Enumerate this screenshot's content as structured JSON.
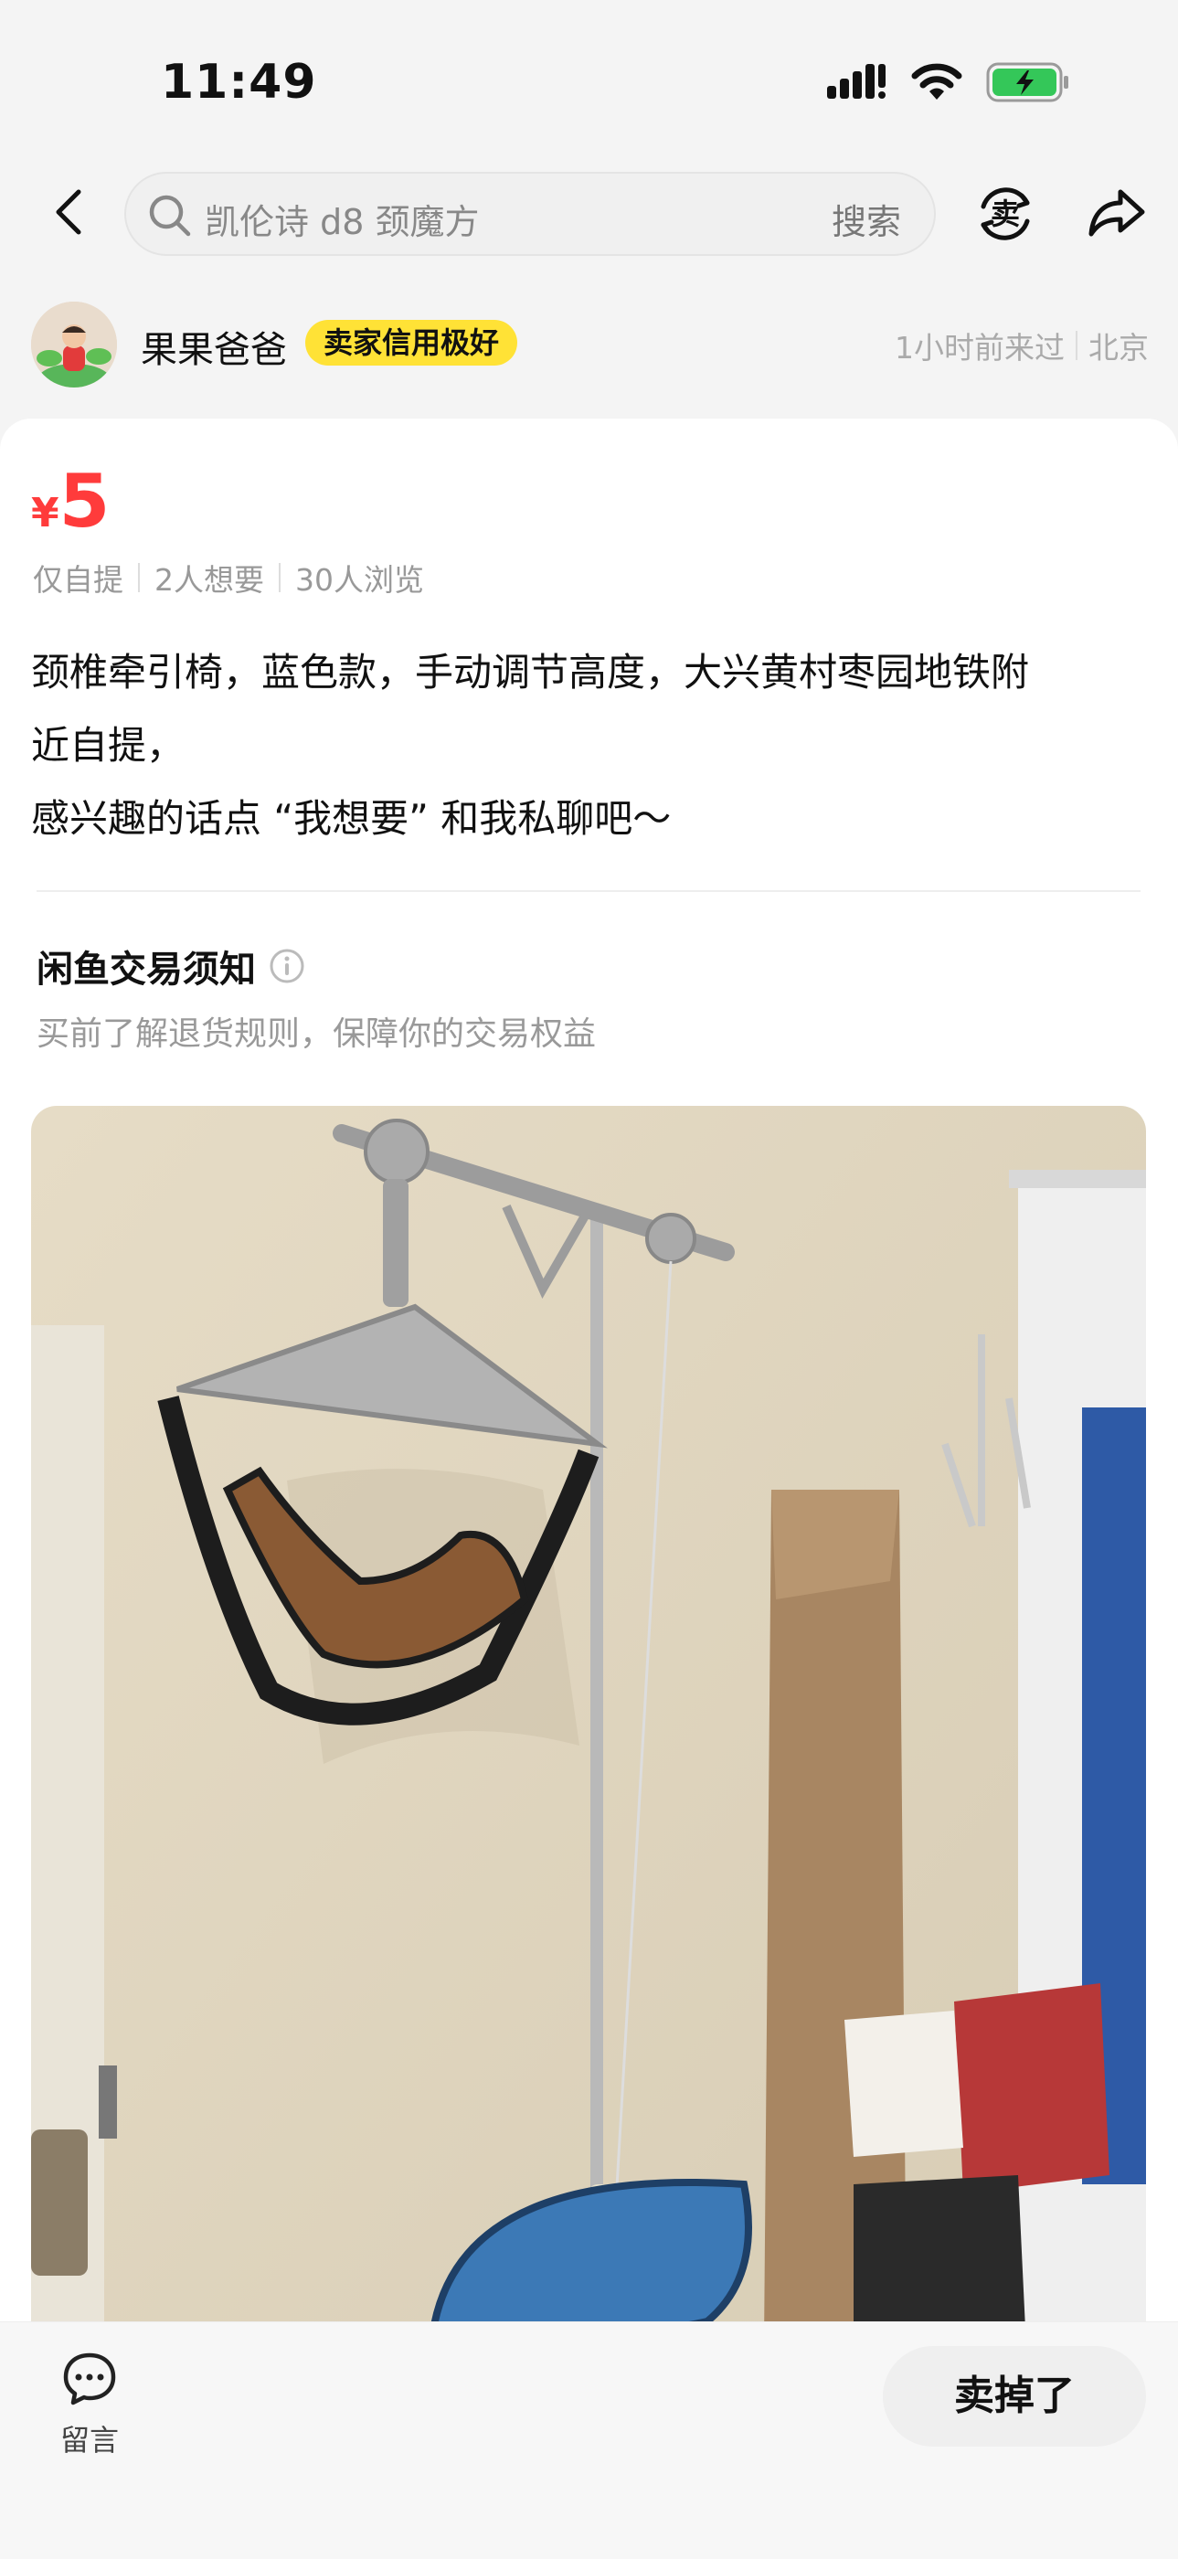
{
  "status_bar": {
    "time": "11:49",
    "battery_charging": true,
    "battery_color": "#34c759"
  },
  "nav": {
    "search_text": "凯伦诗 d8 颈魔方",
    "search_button": "搜索",
    "sell_icon_char": "卖"
  },
  "seller": {
    "name": "果果爸爸",
    "badge": "卖家信用极好",
    "last_seen": "1小时前来过",
    "location": "北京"
  },
  "listing": {
    "currency": "¥",
    "price": "5",
    "delivery": "仅自提",
    "wants": "2人想要",
    "views": "30人浏览",
    "description": "颈椎牵引椅，蓝色款，手动调节高度，大兴黄村枣园地铁附\n近自提，\n感兴趣的话点 “我想要” 和我私聊吧～"
  },
  "notice": {
    "title": "闲鱼交易须知",
    "subtitle": "买前了解退货规则，保障你的交易权益"
  },
  "bottom_bar": {
    "comment_label": "留言",
    "sold_button": "卖掉了"
  },
  "colors": {
    "price": "#ff3b3b",
    "badge_bg": "#ffe236"
  },
  "icons": [
    "back-arrow-icon",
    "search-icon",
    "sell-icon",
    "share-icon",
    "info-icon",
    "comment-bubble-icon",
    "signal-icon",
    "wifi-icon",
    "battery-icon"
  ]
}
